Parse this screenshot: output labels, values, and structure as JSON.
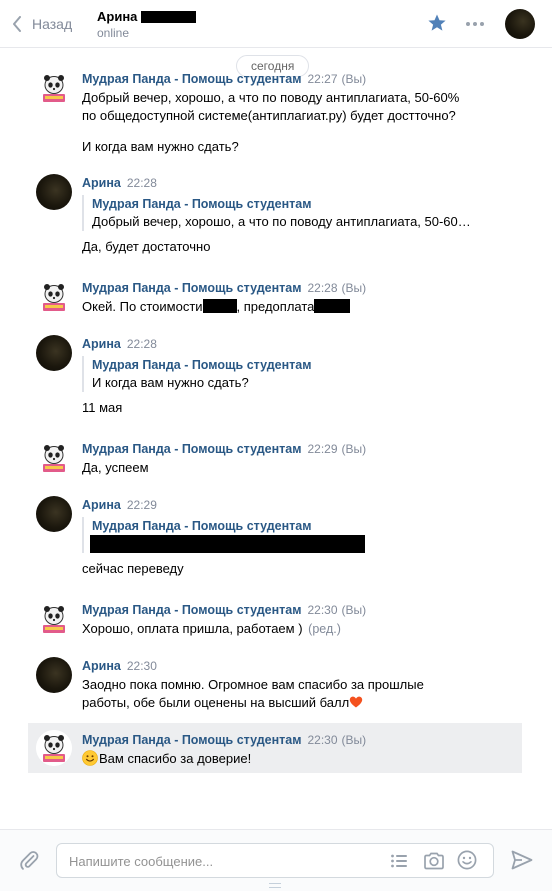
{
  "header": {
    "back_label": "Назад",
    "peer_name": "Арина",
    "peer_status": "online"
  },
  "date_separator": "сегодня",
  "messages": [
    {
      "author": "Мудрая Панда - Помощь студентам",
      "time": "22:27",
      "you_mark": "(Вы)",
      "avatar": "panda-avatar",
      "lines": [
        "Добрый вечер, хорошо, а что по поводу антиплагиата, 50-60%",
        "по общедоступной системе(антиплагиат.ру) будет достточно?",
        "",
        "И когда вам нужно сдать?"
      ]
    },
    {
      "author": "Арина",
      "time": "22:28",
      "avatar": "dark-avatar",
      "quote_author": "Мудрая Панда - Помощь студентам",
      "quote_text": "Добрый вечер, хорошо, а что по поводу антиплагиата, 50-60…",
      "text": "Да, будет достаточно"
    },
    {
      "author": "Мудрая Панда - Помощь студентам",
      "time": "22:28",
      "you_mark": "(Вы)",
      "avatar": "panda-avatar",
      "text_part1": "Окей. По стоимости",
      "text_part2": ", предоплата"
    },
    {
      "author": "Арина",
      "time": "22:28",
      "avatar": "dark-avatar",
      "quote_author": "Мудрая Панда - Помощь студентам",
      "quote_text": "И когда вам нужно сдать?",
      "text": "11 мая"
    },
    {
      "author": "Мудрая Панда - Помощь студентам",
      "time": "22:29",
      "you_mark": "(Вы)",
      "avatar": "panda-avatar",
      "text": "Да, успеем"
    },
    {
      "author": "Арина",
      "time": "22:29",
      "avatar": "dark-avatar",
      "quote_author": "Мудрая Панда - Помощь студентам",
      "text": "сейчас переведу"
    },
    {
      "author": "Мудрая Панда - Помощь студентам",
      "time": "22:30",
      "you_mark": "(Вы)",
      "avatar": "panda-avatar",
      "text": "Хорошо, оплата пришла, работаем )",
      "edited": "(ред.)"
    },
    {
      "author": "Арина",
      "time": "22:30",
      "avatar": "dark-avatar",
      "lines": [
        "Заодно пока помню. Огромное вам спасибо за прошлые",
        "работы, обе были оценены на высший балл"
      ],
      "emoji": "heart-icon"
    },
    {
      "author": "Мудрая Панда - Помощь студентам",
      "time": "22:30",
      "you_mark": "(Вы)",
      "avatar": "panda-avatar",
      "emoji": "smile-emoji",
      "text": "Вам спасибо за доверие!"
    }
  ],
  "composer": {
    "placeholder": "Напишите сообщение..."
  },
  "colors": {
    "link": "#2a5885",
    "muted": "#828a99",
    "star": "#5181b8",
    "highlight": "#edeef0"
  }
}
